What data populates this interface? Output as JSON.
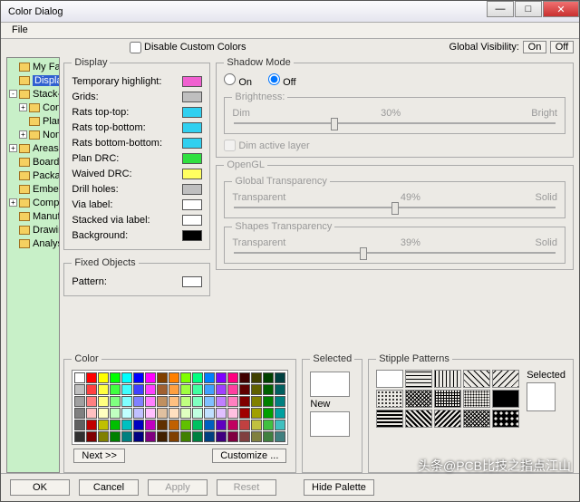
{
  "title": "Color Dialog",
  "menu": {
    "file": "File"
  },
  "topbar": {
    "disable": "Disable Custom Colors",
    "gv": "Global Visibility:",
    "on": "On",
    "off": "Off"
  },
  "tree": {
    "items": [
      {
        "label": "My Favorites",
        "depth": 0,
        "exp": ""
      },
      {
        "label": "Display",
        "depth": 0,
        "exp": "",
        "sel": true
      },
      {
        "label": "Stack-Up",
        "depth": 0,
        "exp": "-"
      },
      {
        "label": "Conductor",
        "depth": 1,
        "exp": "+"
      },
      {
        "label": "Plan",
        "depth": 1,
        "exp": ""
      },
      {
        "label": "Non-Condu..",
        "depth": 1,
        "exp": "+"
      },
      {
        "label": "Areas",
        "depth": 0,
        "exp": "+"
      },
      {
        "label": "Board Geometry",
        "depth": 0,
        "exp": ""
      },
      {
        "label": "Package Geom..",
        "depth": 0,
        "exp": ""
      },
      {
        "label": "Embedded Geom..",
        "depth": 0,
        "exp": ""
      },
      {
        "label": "Components",
        "depth": 0,
        "exp": "+"
      },
      {
        "label": "Manufacturing",
        "depth": 0,
        "exp": ""
      },
      {
        "label": "Drawing Format",
        "depth": 0,
        "exp": ""
      },
      {
        "label": "Analysis",
        "depth": 0,
        "exp": ""
      }
    ]
  },
  "display": {
    "legend": "Display",
    "items": [
      {
        "label": "Temporary highlight:",
        "color": "#f060d0"
      },
      {
        "label": "Grids:",
        "color": "#bfbfbf"
      },
      {
        "label": "Rats top-top:",
        "color": "#30d0f0"
      },
      {
        "label": "Rats top-bottom:",
        "color": "#30d0f0"
      },
      {
        "label": "Rats bottom-bottom:",
        "color": "#30d0f0"
      },
      {
        "label": "Plan DRC:",
        "color": "#30e040"
      },
      {
        "label": "Waived DRC:",
        "color": "#ffff60"
      },
      {
        "label": "Drill holes:",
        "color": "#bfbfbf"
      },
      {
        "label": "Via label:",
        "color": "#ffffff"
      },
      {
        "label": "Stacked via label:",
        "color": "#ffffff"
      },
      {
        "label": "Background:",
        "color": "#000000"
      }
    ]
  },
  "fixed": {
    "legend": "Fixed Objects",
    "pattern": "Pattern:"
  },
  "shadow": {
    "legend": "Shadow Mode",
    "on": "On",
    "off": "Off",
    "brightness_legend": "Brightness:",
    "dim": "Dim",
    "bright": "Bright",
    "val": "30%",
    "dim_active": "Dim active layer"
  },
  "opengl": {
    "legend": "OpenGL",
    "global": {
      "legend": "Global Transparency",
      "t": "Transparent",
      "s": "Solid",
      "val": "49%"
    },
    "shapes": {
      "legend": "Shapes Transparency",
      "t": "Transparent",
      "s": "Solid",
      "val": "39%"
    }
  },
  "color": {
    "legend": "Color",
    "next": "Next >>",
    "customize": "Customize ..."
  },
  "selected": "Selected",
  "new": "New",
  "stipple": {
    "legend": "Stipple Patterns",
    "selected": "Selected"
  },
  "buttons": {
    "ok": "OK",
    "cancel": "Cancel",
    "apply": "Apply",
    "reset": "Reset",
    "hide": "Hide Palette"
  },
  "palette": [
    "#ffffff",
    "#ff0000",
    "#ffff00",
    "#00ff00",
    "#00ffff",
    "#0000ff",
    "#ff00ff",
    "#804000",
    "#ff8000",
    "#80ff00",
    "#00ff80",
    "#0080ff",
    "#8000ff",
    "#ff0080",
    "#400000",
    "#404000",
    "#004000",
    "#004040",
    "#c0c0c0",
    "#ff4040",
    "#ffff40",
    "#40ff40",
    "#40ffff",
    "#4040ff",
    "#ff40ff",
    "#a06030",
    "#ffa040",
    "#a0ff40",
    "#40ffa0",
    "#40a0ff",
    "#a040ff",
    "#ff40a0",
    "#600000",
    "#606000",
    "#006000",
    "#006060",
    "#a0a0a0",
    "#ff8080",
    "#ffff80",
    "#80ff80",
    "#80ffff",
    "#8080ff",
    "#ff80ff",
    "#c09060",
    "#ffc080",
    "#c0ff80",
    "#80ffc0",
    "#80c0ff",
    "#c080ff",
    "#ff80c0",
    "#800000",
    "#808000",
    "#008000",
    "#008080",
    "#808080",
    "#ffc0c0",
    "#ffffc0",
    "#c0ffc0",
    "#c0ffff",
    "#c0c0ff",
    "#ffc0ff",
    "#e0c0a0",
    "#ffe0c0",
    "#e0ffc0",
    "#c0ffe0",
    "#c0e0ff",
    "#e0c0ff",
    "#ffc0e0",
    "#a00000",
    "#a0a000",
    "#00a000",
    "#00a0a0",
    "#606060",
    "#c00000",
    "#c0c000",
    "#00c000",
    "#00c0c0",
    "#0000c0",
    "#c000c0",
    "#603000",
    "#c06000",
    "#60c000",
    "#00c060",
    "#0060c0",
    "#6000c0",
    "#c00060",
    "#c04040",
    "#c0c040",
    "#40c040",
    "#40c0c0",
    "#303030",
    "#800000",
    "#808000",
    "#008000",
    "#008080",
    "#000080",
    "#800080",
    "#402000",
    "#804000",
    "#408000",
    "#008040",
    "#004080",
    "#400080",
    "#800040",
    "#804040",
    "#808040",
    "#408040",
    "#408080"
  ],
  "watermark": "头条@PCB比技之指点江山"
}
